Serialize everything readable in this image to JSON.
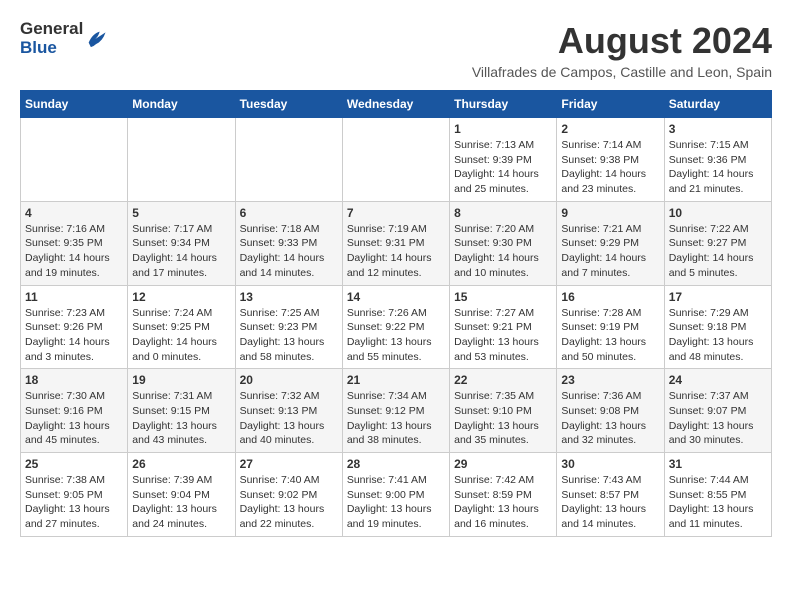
{
  "header": {
    "logo_general": "General",
    "logo_blue": "Blue",
    "month_title": "August 2024",
    "subtitle": "Villafrades de Campos, Castille and Leon, Spain"
  },
  "days_of_week": [
    "Sunday",
    "Monday",
    "Tuesday",
    "Wednesday",
    "Thursday",
    "Friday",
    "Saturday"
  ],
  "weeks": [
    {
      "days": [
        {
          "num": "",
          "info": ""
        },
        {
          "num": "",
          "info": ""
        },
        {
          "num": "",
          "info": ""
        },
        {
          "num": "",
          "info": ""
        },
        {
          "num": "1",
          "info": "Sunrise: 7:13 AM\nSunset: 9:39 PM\nDaylight: 14 hours and 25 minutes."
        },
        {
          "num": "2",
          "info": "Sunrise: 7:14 AM\nSunset: 9:38 PM\nDaylight: 14 hours and 23 minutes."
        },
        {
          "num": "3",
          "info": "Sunrise: 7:15 AM\nSunset: 9:36 PM\nDaylight: 14 hours and 21 minutes."
        }
      ]
    },
    {
      "days": [
        {
          "num": "4",
          "info": "Sunrise: 7:16 AM\nSunset: 9:35 PM\nDaylight: 14 hours and 19 minutes."
        },
        {
          "num": "5",
          "info": "Sunrise: 7:17 AM\nSunset: 9:34 PM\nDaylight: 14 hours and 17 minutes."
        },
        {
          "num": "6",
          "info": "Sunrise: 7:18 AM\nSunset: 9:33 PM\nDaylight: 14 hours and 14 minutes."
        },
        {
          "num": "7",
          "info": "Sunrise: 7:19 AM\nSunset: 9:31 PM\nDaylight: 14 hours and 12 minutes."
        },
        {
          "num": "8",
          "info": "Sunrise: 7:20 AM\nSunset: 9:30 PM\nDaylight: 14 hours and 10 minutes."
        },
        {
          "num": "9",
          "info": "Sunrise: 7:21 AM\nSunset: 9:29 PM\nDaylight: 14 hours and 7 minutes."
        },
        {
          "num": "10",
          "info": "Sunrise: 7:22 AM\nSunset: 9:27 PM\nDaylight: 14 hours and 5 minutes."
        }
      ]
    },
    {
      "days": [
        {
          "num": "11",
          "info": "Sunrise: 7:23 AM\nSunset: 9:26 PM\nDaylight: 14 hours and 3 minutes."
        },
        {
          "num": "12",
          "info": "Sunrise: 7:24 AM\nSunset: 9:25 PM\nDaylight: 14 hours and 0 minutes."
        },
        {
          "num": "13",
          "info": "Sunrise: 7:25 AM\nSunset: 9:23 PM\nDaylight: 13 hours and 58 minutes."
        },
        {
          "num": "14",
          "info": "Sunrise: 7:26 AM\nSunset: 9:22 PM\nDaylight: 13 hours and 55 minutes."
        },
        {
          "num": "15",
          "info": "Sunrise: 7:27 AM\nSunset: 9:21 PM\nDaylight: 13 hours and 53 minutes."
        },
        {
          "num": "16",
          "info": "Sunrise: 7:28 AM\nSunset: 9:19 PM\nDaylight: 13 hours and 50 minutes."
        },
        {
          "num": "17",
          "info": "Sunrise: 7:29 AM\nSunset: 9:18 PM\nDaylight: 13 hours and 48 minutes."
        }
      ]
    },
    {
      "days": [
        {
          "num": "18",
          "info": "Sunrise: 7:30 AM\nSunset: 9:16 PM\nDaylight: 13 hours and 45 minutes."
        },
        {
          "num": "19",
          "info": "Sunrise: 7:31 AM\nSunset: 9:15 PM\nDaylight: 13 hours and 43 minutes."
        },
        {
          "num": "20",
          "info": "Sunrise: 7:32 AM\nSunset: 9:13 PM\nDaylight: 13 hours and 40 minutes."
        },
        {
          "num": "21",
          "info": "Sunrise: 7:34 AM\nSunset: 9:12 PM\nDaylight: 13 hours and 38 minutes."
        },
        {
          "num": "22",
          "info": "Sunrise: 7:35 AM\nSunset: 9:10 PM\nDaylight: 13 hours and 35 minutes."
        },
        {
          "num": "23",
          "info": "Sunrise: 7:36 AM\nSunset: 9:08 PM\nDaylight: 13 hours and 32 minutes."
        },
        {
          "num": "24",
          "info": "Sunrise: 7:37 AM\nSunset: 9:07 PM\nDaylight: 13 hours and 30 minutes."
        }
      ]
    },
    {
      "days": [
        {
          "num": "25",
          "info": "Sunrise: 7:38 AM\nSunset: 9:05 PM\nDaylight: 13 hours and 27 minutes."
        },
        {
          "num": "26",
          "info": "Sunrise: 7:39 AM\nSunset: 9:04 PM\nDaylight: 13 hours and 24 minutes."
        },
        {
          "num": "27",
          "info": "Sunrise: 7:40 AM\nSunset: 9:02 PM\nDaylight: 13 hours and 22 minutes."
        },
        {
          "num": "28",
          "info": "Sunrise: 7:41 AM\nSunset: 9:00 PM\nDaylight: 13 hours and 19 minutes."
        },
        {
          "num": "29",
          "info": "Sunrise: 7:42 AM\nSunset: 8:59 PM\nDaylight: 13 hours and 16 minutes."
        },
        {
          "num": "30",
          "info": "Sunrise: 7:43 AM\nSunset: 8:57 PM\nDaylight: 13 hours and 14 minutes."
        },
        {
          "num": "31",
          "info": "Sunrise: 7:44 AM\nSunset: 8:55 PM\nDaylight: 13 hours and 11 minutes."
        }
      ]
    }
  ]
}
